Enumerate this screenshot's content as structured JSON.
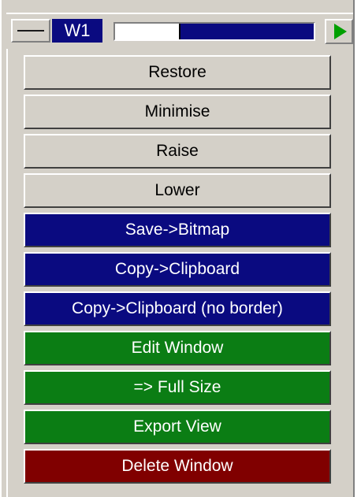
{
  "window_header": {
    "menu_icon": "dash-icon",
    "window_label": "W1",
    "slider_value_fraction": 0.32,
    "play_icon": "play-triangle-icon"
  },
  "colors": {
    "grey": "#d4d0c8",
    "blue": "#0a0a80",
    "green": "#0b7d14",
    "red": "#800000",
    "play_green": "#00a000"
  },
  "menu": {
    "items": [
      {
        "label": "Restore",
        "style": "grey",
        "name": "restore-button"
      },
      {
        "label": "Minimise",
        "style": "grey",
        "name": "minimise-button"
      },
      {
        "label": "Raise",
        "style": "grey",
        "name": "raise-button"
      },
      {
        "label": "Lower",
        "style": "grey",
        "name": "lower-button"
      },
      {
        "label": "Save->Bitmap",
        "style": "blue",
        "name": "save-bitmap-button"
      },
      {
        "label": "Copy->Clipboard",
        "style": "blue",
        "name": "copy-clipboard-button"
      },
      {
        "label": "Copy->Clipboard (no border)",
        "style": "blue",
        "name": "copy-clipboard-no-border-button"
      },
      {
        "label": "Edit Window",
        "style": "green",
        "name": "edit-window-button"
      },
      {
        "label": "=> Full Size",
        "style": "green",
        "name": "full-size-button"
      },
      {
        "label": "Export View",
        "style": "green",
        "name": "export-view-button"
      },
      {
        "label": "Delete Window",
        "style": "red",
        "name": "delete-window-button"
      }
    ]
  }
}
